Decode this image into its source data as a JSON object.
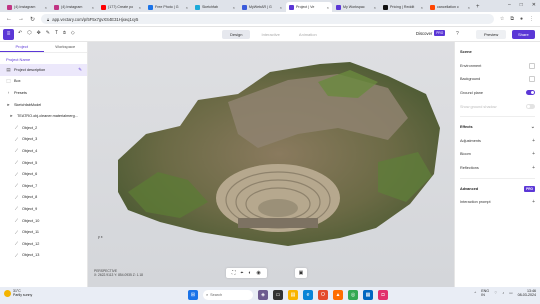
{
  "browser": {
    "tabs": [
      {
        "title": "(4) Instagram",
        "color": "#c13584",
        "active": false
      },
      {
        "title": "(4) Instagram",
        "color": "#c13584",
        "active": false
      },
      {
        "title": "(177) Create po",
        "color": "#ff0000",
        "active": false
      },
      {
        "title": "Free Photo | G",
        "color": "#1a73e8",
        "active": false
      },
      {
        "title": "Sketchfab",
        "color": "#1caad9",
        "active": false
      },
      {
        "title": "MyWebAR | G",
        "color": "#3b5bdb",
        "active": false
      },
      {
        "title": "Project | Ve",
        "color": "#5b37d6",
        "active": true
      },
      {
        "title": "My Workspac",
        "color": "#5b37d6",
        "active": false
      },
      {
        "title": "Pricing | Reddit",
        "color": "#111111",
        "active": false
      },
      {
        "title": "cancellation c",
        "color": "#ff4500",
        "active": false
      }
    ],
    "url": "app.vectary.com/p/5F5x7gvXS4E31Hjxeq1xy5",
    "window_controls": {
      "minimize": "–",
      "maximize": "□",
      "close": "✕"
    }
  },
  "toolbar": {
    "modes": [
      "Design",
      "Interactive",
      "Animation"
    ],
    "active_mode": "Design",
    "discover_label": "Discover",
    "pro_badge": "PRO",
    "preview_label": "Preview",
    "share_label": "Share"
  },
  "left_panel": {
    "tabs": [
      "Project",
      "Workspace"
    ],
    "section_title": "Project Name",
    "rows": [
      {
        "label": "Project description",
        "icon": "description-icon",
        "kind": "sel"
      },
      {
        "label": "Box",
        "icon": "box-icon",
        "kind": "top"
      },
      {
        "label": "Presets",
        "icon": "presets-icon",
        "kind": "top"
      },
      {
        "label": "SketchfabModel",
        "icon": "folder-icon",
        "kind": "top"
      },
      {
        "label": "TEATRO.obj.cleaner.materialmerg...",
        "icon": "folder-icon",
        "kind": "sub"
      },
      {
        "label": "Object_2",
        "icon": "mesh-icon",
        "kind": "obj"
      },
      {
        "label": "Object_3",
        "icon": "mesh-icon",
        "kind": "obj"
      },
      {
        "label": "Object_4",
        "icon": "mesh-icon",
        "kind": "obj"
      },
      {
        "label": "Object_5",
        "icon": "mesh-icon",
        "kind": "obj"
      },
      {
        "label": "Object_6",
        "icon": "mesh-icon",
        "kind": "obj"
      },
      {
        "label": "Object_7",
        "icon": "mesh-icon",
        "kind": "obj"
      },
      {
        "label": "Object_8",
        "icon": "mesh-icon",
        "kind": "obj"
      },
      {
        "label": "Object_9",
        "icon": "mesh-icon",
        "kind": "obj"
      },
      {
        "label": "Object_10",
        "icon": "mesh-icon",
        "kind": "obj"
      },
      {
        "label": "Object_11",
        "icon": "mesh-icon",
        "kind": "obj"
      },
      {
        "label": "Object_12",
        "icon": "mesh-icon",
        "kind": "obj"
      },
      {
        "label": "Object_13",
        "icon": "mesh-icon",
        "kind": "obj"
      }
    ]
  },
  "viewport": {
    "view_label": "PERSPECTIVE",
    "coords": "X: 2622.9113  Y: 854.0935  Z: 1.18",
    "axes_label": "y  x"
  },
  "right_panel": {
    "scene_title": "Scene",
    "scene_rows": [
      {
        "label": "Environment",
        "control": "swatch"
      },
      {
        "label": "Background",
        "control": "swatch"
      },
      {
        "label": "Ground plane",
        "control": "toggle-on"
      },
      {
        "label": "Show ground shadow",
        "control": "toggle-off",
        "dim": true
      }
    ],
    "effects_title": "Effects",
    "effects_rows": [
      "Adjustments",
      "Bloom",
      "Reflections"
    ],
    "advanced_title": "Advanced",
    "advanced_badge": "PRO",
    "advanced_rows": [
      "Interaction prompt"
    ]
  },
  "taskbar": {
    "weather_temp": "31°C",
    "weather_desc": "Partly sunny",
    "search_placeholder": "Search",
    "lang": "ENG",
    "region": "IN",
    "time": "13:46",
    "date": "08-03-2024"
  },
  "colors": {
    "accent": "#5b37d6"
  }
}
